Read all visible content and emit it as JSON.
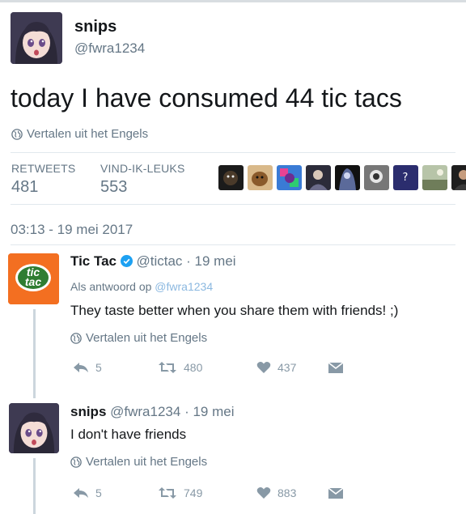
{
  "main_tweet": {
    "display_name": "snips",
    "handle": "@fwra1234",
    "text": "today I have consumed 44 tic tacs",
    "translate": "Vertalen uit het Engels",
    "retweets_label": "RETWEETS",
    "retweets_count": "481",
    "likes_label": "VIND-IK-LEUKS",
    "likes_count": "553",
    "timestamp": "03:13 - 19 mei 2017"
  },
  "replies": [
    {
      "display_name": "Tic Tac",
      "handle": "@tictac",
      "time": "· 19 mei",
      "reply_prefix": "Als antwoord op",
      "reply_handle": "@fwra1234",
      "text": "They taste better when you share them with friends! ;)",
      "translate": "Vertalen uit het Engels",
      "reply_count": "5",
      "retweet_count": "480",
      "like_count": "437"
    },
    {
      "display_name": "snips",
      "handle": "@fwra1234",
      "time": "· 19 mei",
      "text": "I don't have friends",
      "translate": "Vertalen uit het Engels",
      "reply_count": "5",
      "retweet_count": "749",
      "like_count": "883"
    }
  ],
  "brand": {
    "tictac_logo_text_1": "tic",
    "tictac_logo_text_2": "tac"
  },
  "colors": {
    "muted": "#657786",
    "verified": "#1da1f2",
    "tictac_orange": "#f36f21",
    "tictac_green": "#2f7d32"
  }
}
